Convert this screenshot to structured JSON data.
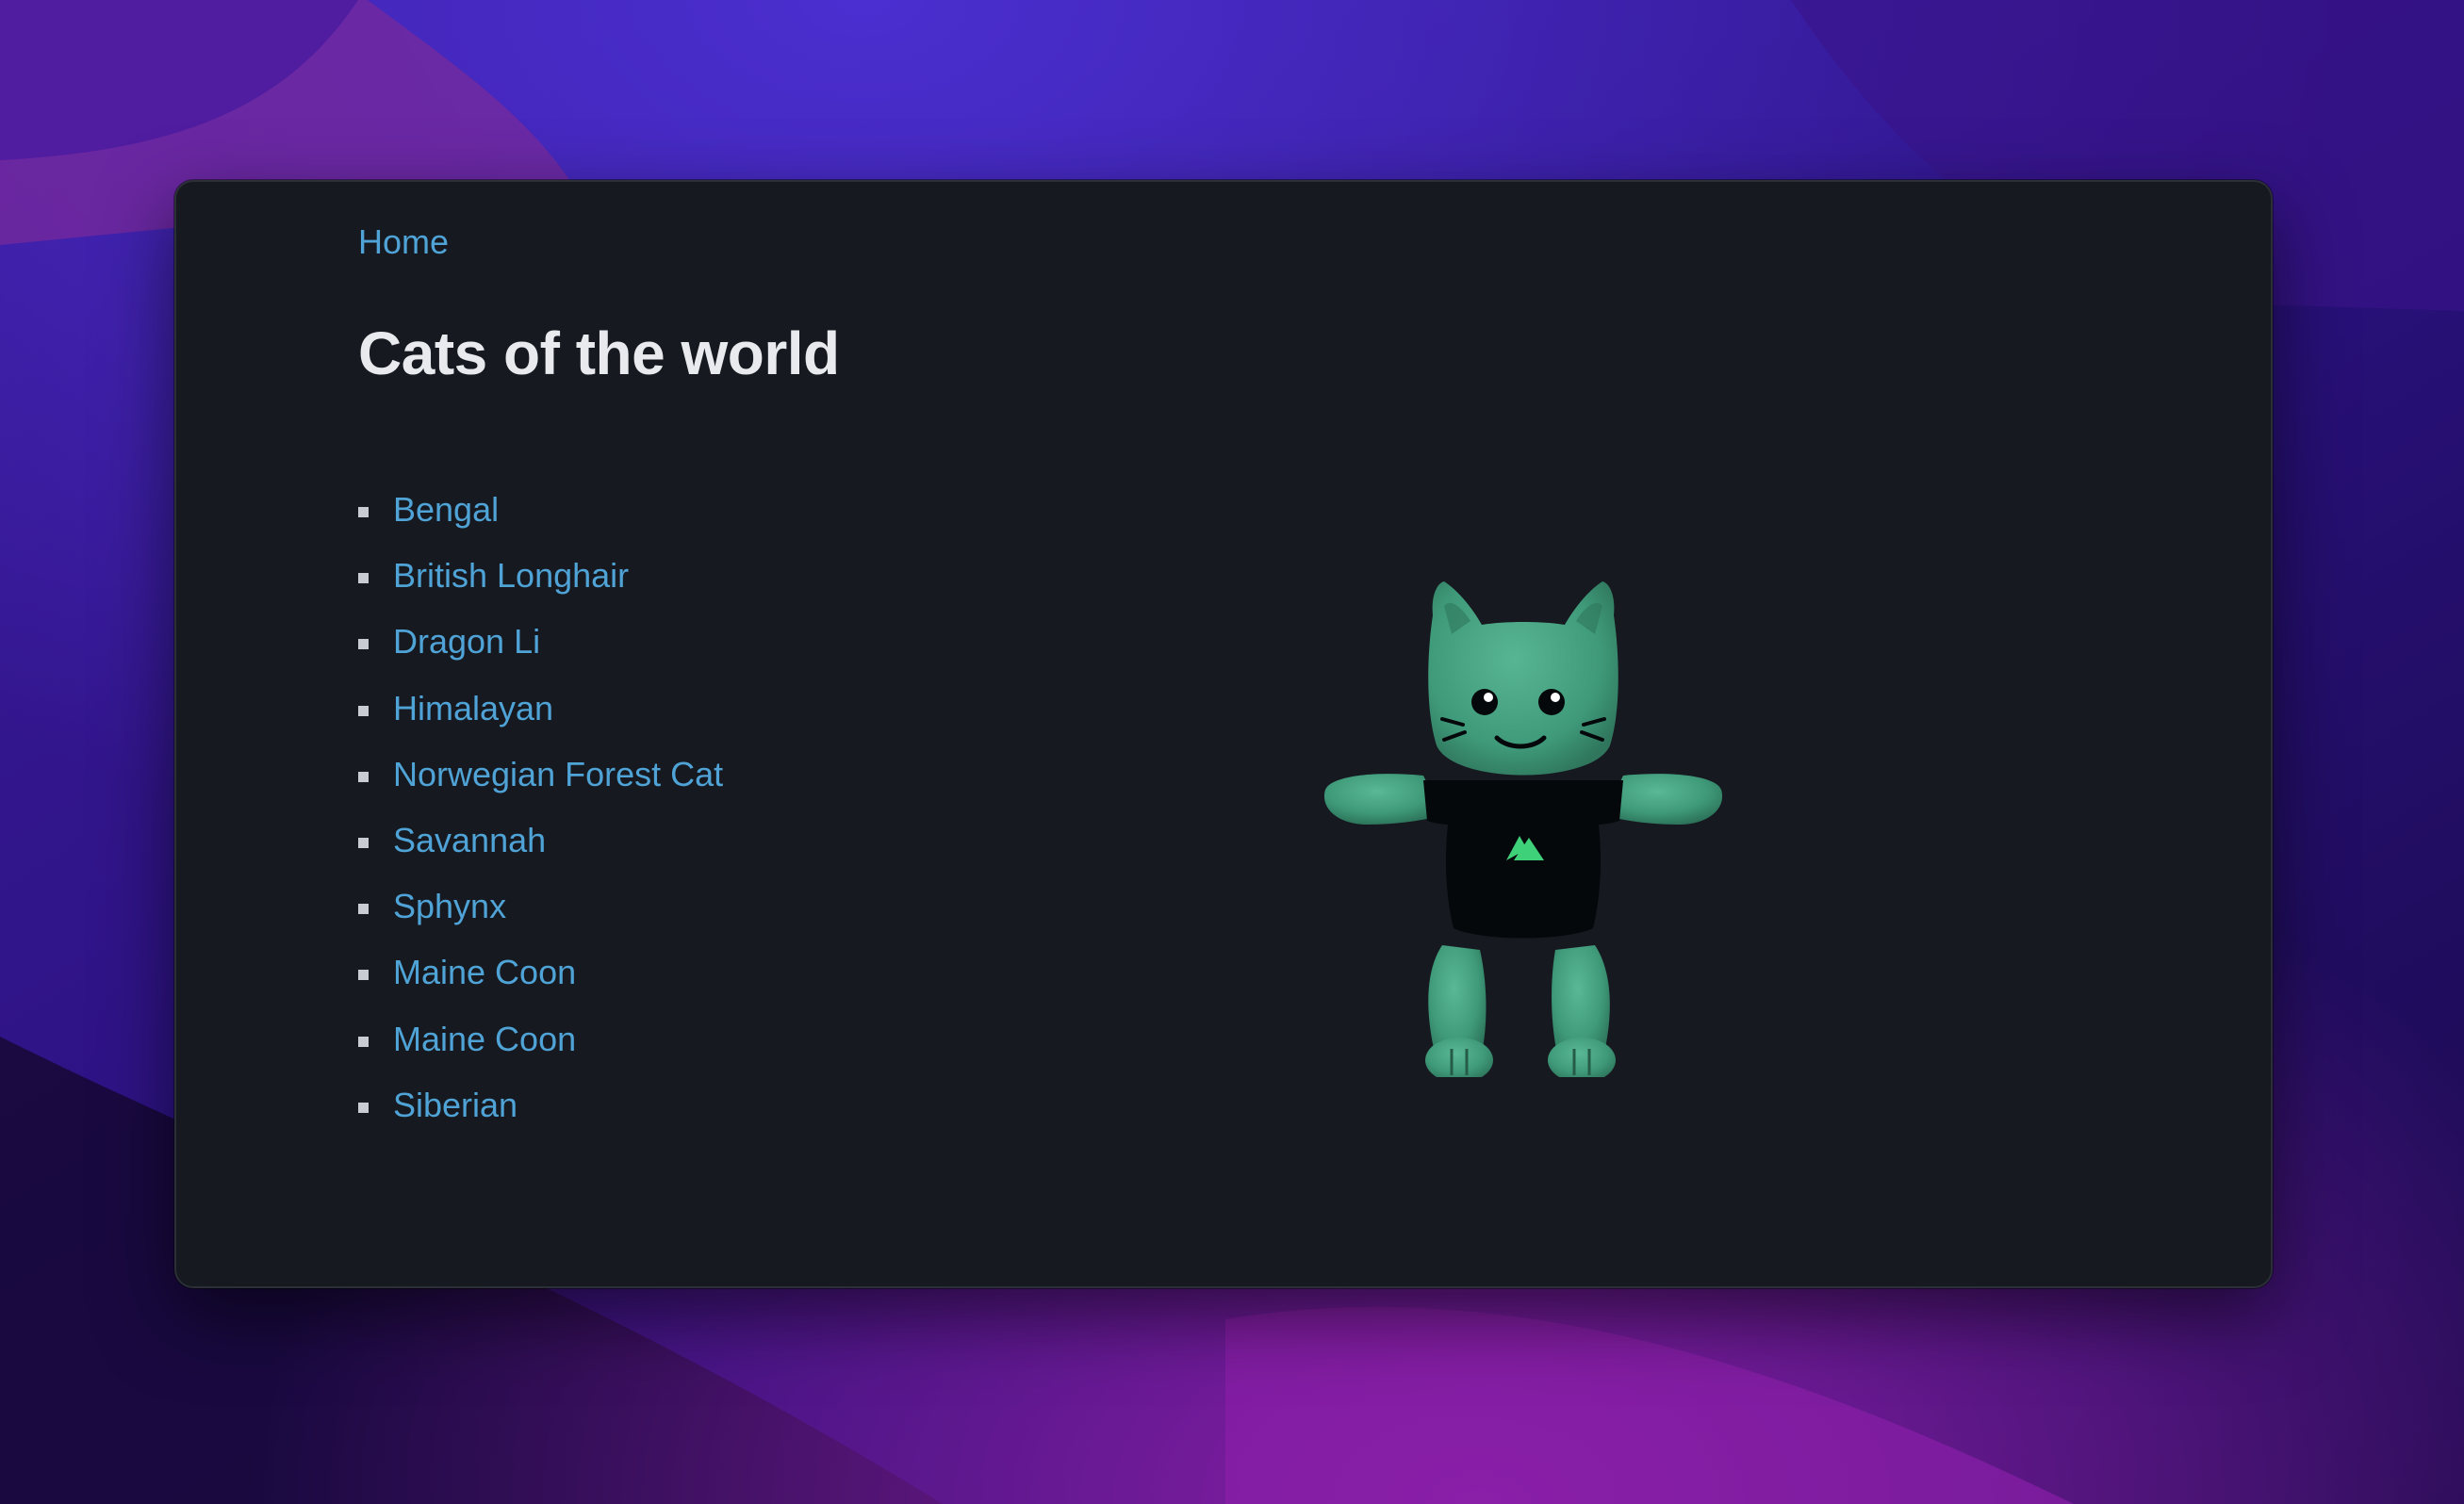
{
  "nav": {
    "home_label": "Home"
  },
  "page": {
    "title": "Cats of the world"
  },
  "breeds": [
    {
      "label": "Bengal"
    },
    {
      "label": "British Longhair"
    },
    {
      "label": "Dragon Li"
    },
    {
      "label": "Himalayan"
    },
    {
      "label": "Norwegian Forest Cat"
    },
    {
      "label": "Savannah"
    },
    {
      "label": "Sphynx"
    },
    {
      "label": "Maine Coon"
    },
    {
      "label": "Maine Coon"
    },
    {
      "label": "Siberian"
    }
  ],
  "mascot": {
    "icon": "green-cat-mascot-3d",
    "body_color": "#3f9a7a",
    "shirt_color": "#05080a",
    "logo_color": "#3fd07a"
  },
  "theme": {
    "background": "#161a20",
    "link_color": "#4fa3d6",
    "title_color": "#e8eaee"
  }
}
